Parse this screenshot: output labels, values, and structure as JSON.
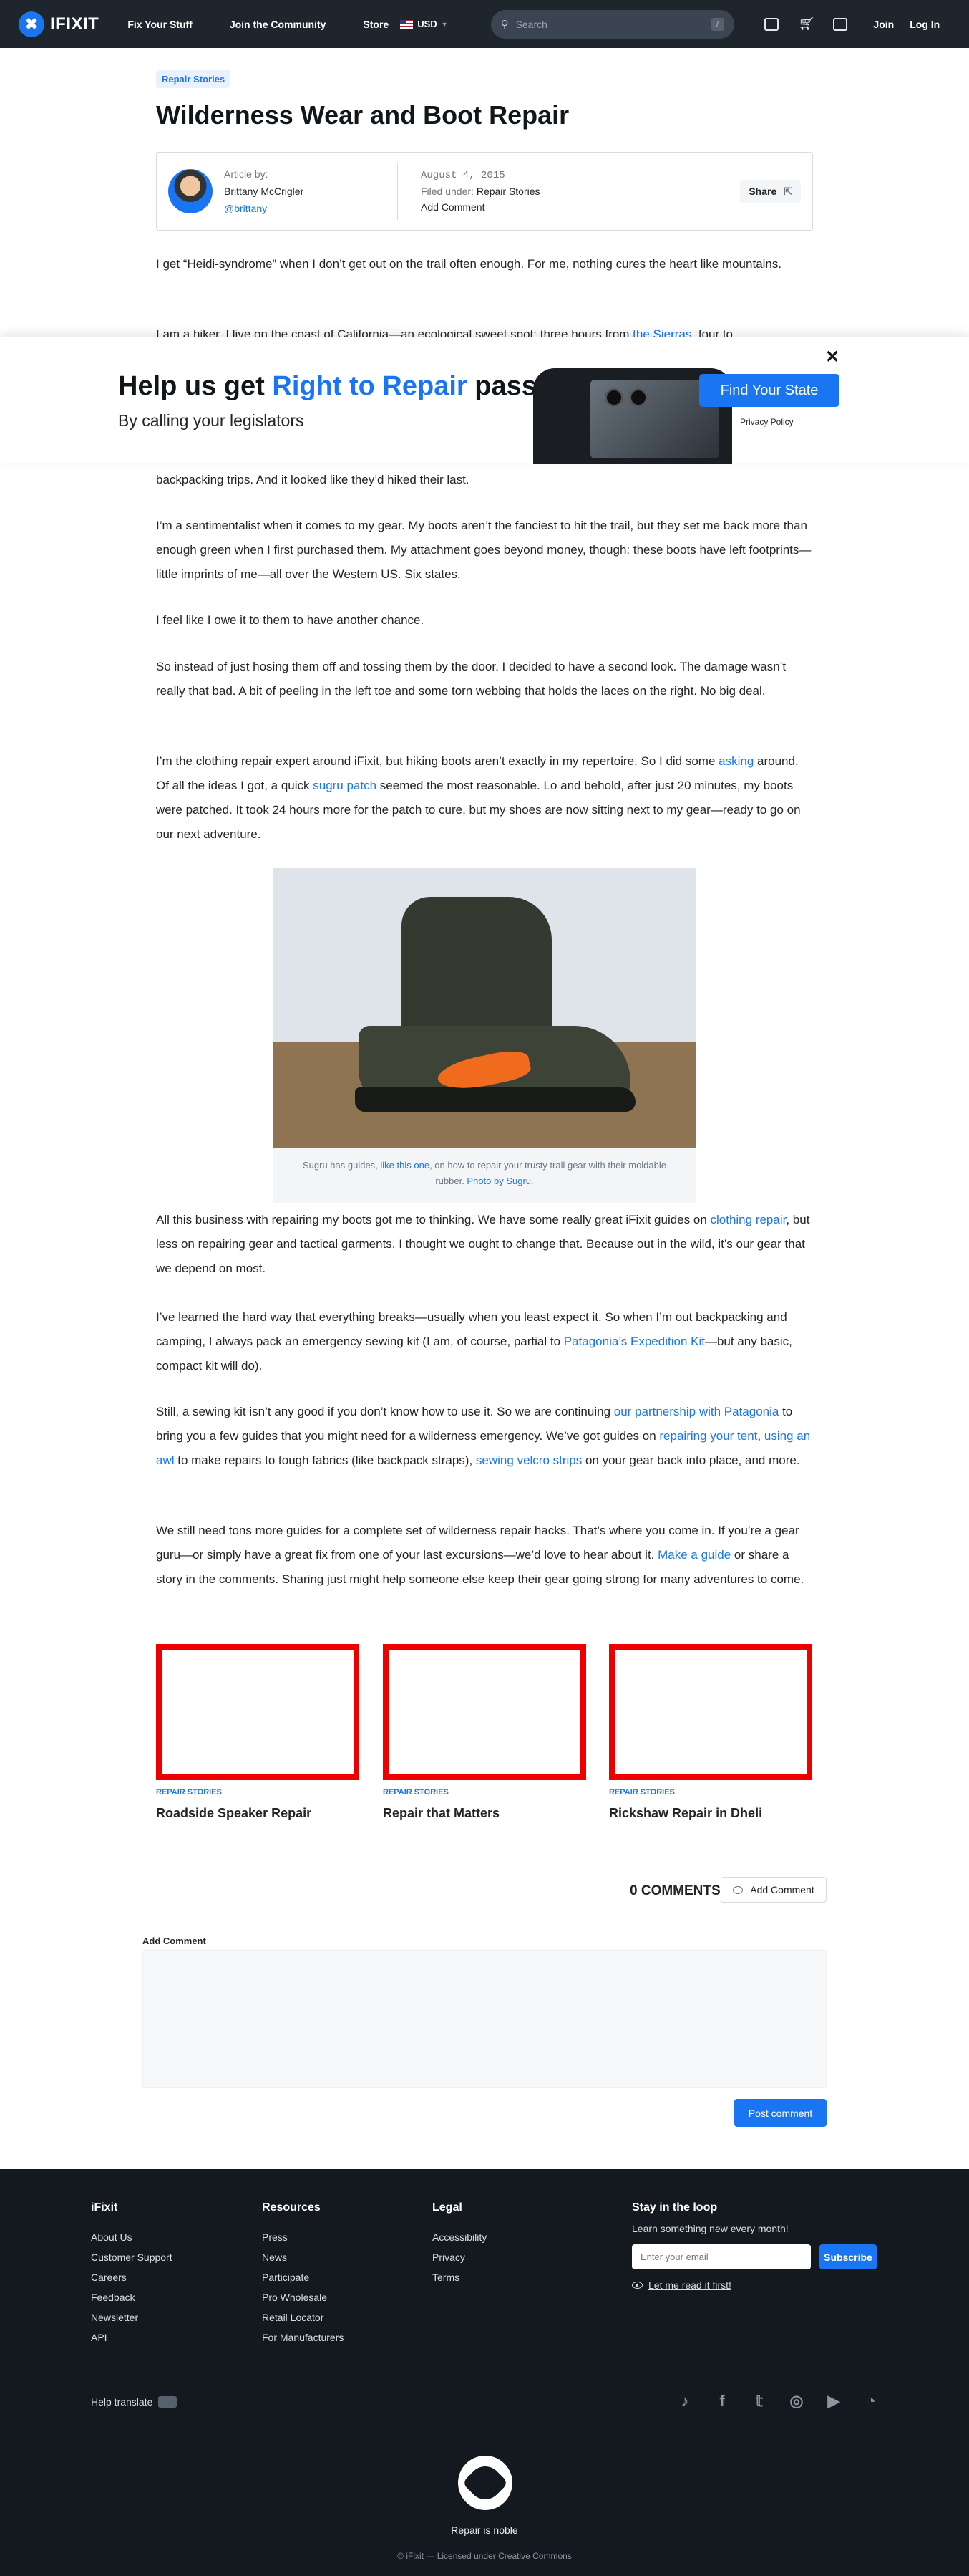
{
  "nav": {
    "logo": "IFIXIT",
    "links": [
      "Fix Your Stuff",
      "Join the Community",
      "Store"
    ],
    "currency": "USD",
    "search_placeholder": "Search",
    "search_key": "/",
    "join": "Join",
    "login": "Log In"
  },
  "article": {
    "category": "Repair Stories",
    "title": "Wilderness Wear and Boot Repair",
    "author_label": "Article by:",
    "author_name": "Brittany McCrigler",
    "author_handle": "@brittany",
    "date": "August 4, 2015",
    "filed_label": "Filed under:",
    "filed_value": "Repair Stories",
    "add_comment": "Add Comment",
    "share": "Share",
    "p1": "I get “Heidi-syndrome” when I don’t get out on the trail often enough. For me, nothing cures the heart like mountains.",
    "p2_start": "I am a hiker. I live on the coast of California—an ecological sweet spot: three hours from ",
    "p2_link": "the Sierras",
    "p2_end": ", four to",
    "p3": "backpacking trips. And it looked like they’d hiked their last.",
    "p4": "I’m a sentimentalist when it comes to my gear. My boots aren’t the fanciest to hit the trail, but they set me back more than enough green when I first purchased them. My attachment goes beyond money, though: these boots have left footprints—little imprints of me—all over the Western US. Six states.",
    "p5": "I feel like I owe it to them to have another chance.",
    "p6": "So instead of just hosing them off and tossing them by the door, I decided to have a second look. The damage wasn’t really that bad. A bit of peeling in the left toe and some torn webbing that holds the laces on the right. No big deal.",
    "p7_a": "I’m the clothing repair expert around iFixit, but hiking boots aren’t exactly in my repertoire. So I did some ",
    "p7_link1": "asking",
    "p7_b": " around. Of all the ideas I got, a quick ",
    "p7_link2": "sugru patch",
    "p7_c": " seemed the most reasonable. Lo and behold, after just 20 minutes, my boots were patched. It took 24 hours more for the patch to cure, but my shoes are now sitting next to my gear—ready to go on our next adventure.",
    "caption_a": "Sugru has guides, ",
    "caption_link1": "like this one",
    "caption_b": ", on how to repair your trusty trail gear with their moldable rubber. ",
    "caption_link2": "Photo by Sugru",
    "caption_c": ".",
    "p8_a": "All this business with repairing my boots got me to thinking. We have some really great iFixit guides on ",
    "p8_link": "clothing repair",
    "p8_b": ", but less on repairing gear and tactical garments. I thought we ought to change that. Because out in the wild, it’s our gear that we depend on most.",
    "p9_a": "I’ve learned the hard way that everything breaks—usually when you least expect it. So when I’m out backpacking and camping, I always pack an emergency sewing kit (I am, of course, partial to ",
    "p9_link": "Patagonia’s Expedition Kit",
    "p9_b": "—but any basic, compact kit will do).",
    "p10_a": "Still, a sewing kit isn’t any good if you don’t know how to use it. So we are continuing ",
    "p10_link1": "our partnership with Patagonia",
    "p10_b": " to bring you a few guides that you might need for a wilderness emergency. We’ve got guides on ",
    "p10_link2": "repairing your tent",
    "p10_c": ", ",
    "p10_link3": "using an awl",
    "p10_d": " to make repairs to tough fabrics (like backpack straps), ",
    "p10_link4": "sewing velcro strips",
    "p10_e": " on your gear back into place, and more.",
    "p11_a": "We still need tons more guides for a complete set of wilderness repair hacks. That’s where you come in. If you’re a gear guru—or simply have a great fix from one of your last excursions—we’d love to hear about it. ",
    "p11_link": "Make a guide",
    "p11_b": " or share a story in the comments. Sharing just might help someone else keep their gear going strong for many adventures to come."
  },
  "banner": {
    "title_a": "Help us get ",
    "title_hl": "Right to Repair",
    "title_b": " passed",
    "subtitle": "By calling your legislators",
    "cta": "Find Your State",
    "privacy": "Privacy Policy",
    "close": "✕"
  },
  "related": [
    {
      "category": "REPAIR STORIES",
      "title": "Roadside Speaker Repair"
    },
    {
      "category": "REPAIR STORIES",
      "title": "Repair that Matters"
    },
    {
      "category": "REPAIR STORIES",
      "title": "Rickshaw Repair in Dheli"
    }
  ],
  "comments": {
    "count": "0 COMMENTS",
    "add_button": "Add Comment",
    "add_label": "Add Comment",
    "post": "Post comment"
  },
  "footer": {
    "col1": {
      "title": "iFixit",
      "links": [
        "About Us",
        "Customer Support",
        "Careers",
        "Feedback",
        "Newsletter",
        "API"
      ]
    },
    "col2": {
      "title": "Resources",
      "links": [
        "Press",
        "News",
        "Participate",
        "Pro Wholesale",
        "Retail Locator",
        "For Manufacturers"
      ]
    },
    "col3": {
      "title": "Legal",
      "links": [
        "Accessibility",
        "Privacy",
        "Terms"
      ]
    },
    "stay_title": "Stay in the loop",
    "stay_text": "Learn something new every month!",
    "email_placeholder": "Enter your email",
    "subscribe": "Subscribe",
    "read_first": "Let me read it first!",
    "help_translate": "Help translate",
    "socials": [
      "tiktok-icon",
      "facebook-icon",
      "twitter-icon",
      "instagram-icon",
      "youtube-icon",
      "mastodon-icon"
    ],
    "tagline": "Repair is noble",
    "license": "© iFixit — Licensed under Creative Commons"
  },
  "colors": {
    "brand": "#1975f1",
    "nav_bg": "#1e252d",
    "footer_bg": "#14191f",
    "placeholder_border": "#ee0000"
  }
}
